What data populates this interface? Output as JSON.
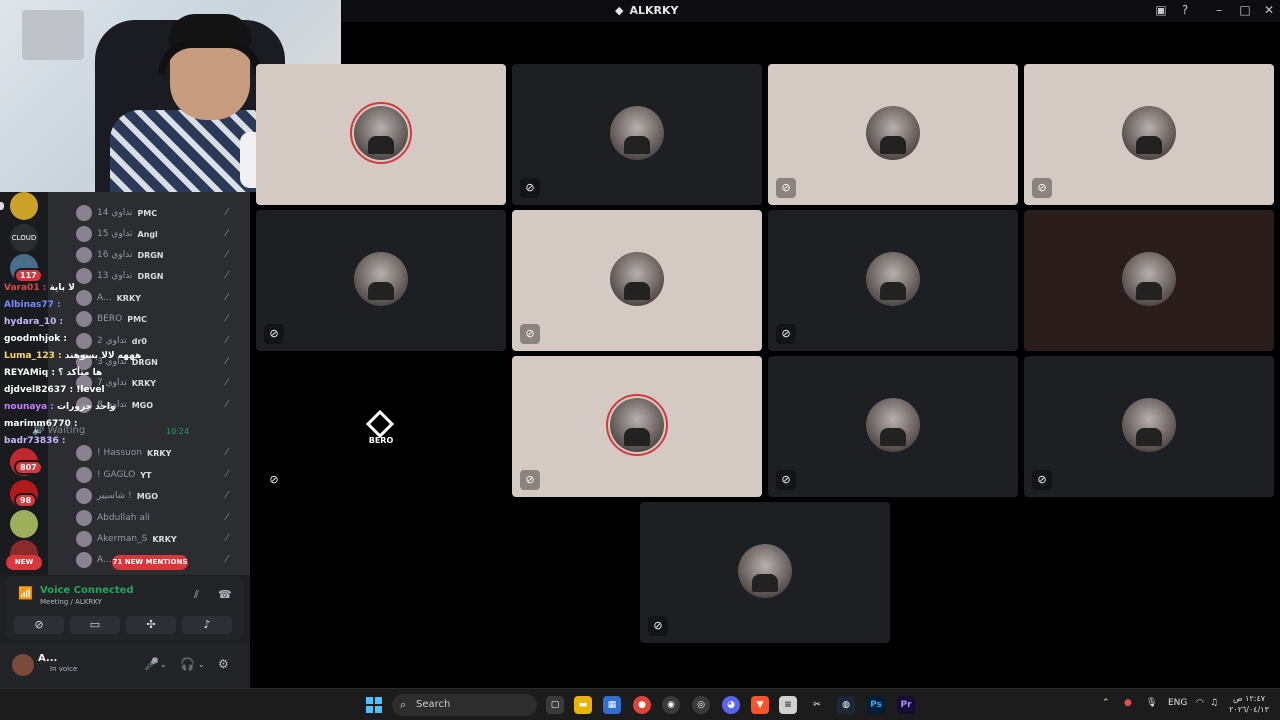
{
  "window": {
    "title": "ALKRKY"
  },
  "members": [
    {
      "name": "تداوي 14",
      "tag": "PMC"
    },
    {
      "name": "تداوي 15",
      "tag": "Angl"
    },
    {
      "name": "تداوي 16",
      "tag": "DRGN"
    },
    {
      "name": "تداوي 13",
      "tag": "DRGN"
    },
    {
      "name": "A...",
      "tag": "KRKY"
    },
    {
      "name": "BERO",
      "tag": "PMC"
    },
    {
      "name": "تداوي 2",
      "tag": "dr0"
    },
    {
      "name": "تداوي 3",
      "tag": "DRGN"
    },
    {
      "name": "تداوي 7",
      "tag": "KRKY"
    },
    {
      "name": "تداوي 8",
      "tag": "MGO"
    },
    {
      "name": "! Hassuon",
      "tag": "KRKY"
    },
    {
      "name": "! GAGLO",
      "tag": "YT"
    },
    {
      "name": "شاسيير !",
      "tag": "MGO"
    },
    {
      "name": "Abdullah ali",
      "tag": ""
    },
    {
      "name": "Akerman_S",
      "tag": "KRKY"
    },
    {
      "name": "A...",
      "tag": ""
    }
  ],
  "waiting": {
    "label": "Waiting",
    "time": "10:24"
  },
  "mentions": {
    "label": "71 NEW MENTIONS"
  },
  "new_pill": "NEW",
  "guild_badges": [
    "117",
    "807",
    "98"
  ],
  "chat": [
    {
      "user": "Vara01 :",
      "text": "لا باية",
      "color": "#d84a4a"
    },
    {
      "user": "Albinas77 :",
      "text": "",
      "color": "#7a8cff"
    },
    {
      "user": "hydara_10 :",
      "text": "",
      "color": "#c9b5ff"
    },
    {
      "user": "goodmhjok :",
      "text": "",
      "color": "#ffffff"
    },
    {
      "user": "Luma_123 :",
      "text": "هههه لالا بسوهند",
      "color": "#ffd966"
    },
    {
      "user": "REYAMiq :",
      "text": "ها متأكد ؟",
      "color": "#ffffff"
    },
    {
      "user": "djdvel82637 :",
      "text": "!level",
      "color": "#ffffff"
    },
    {
      "user": "nounaya :",
      "text": "واحد حزورات",
      "color": "#c77dff"
    },
    {
      "user": "marimm6770 :",
      "text": "",
      "color": "#ffffff"
    },
    {
      "user": "badr73836 :",
      "text": "",
      "color": "#c9b5ff"
    }
  ],
  "voice": {
    "status": "Voice Connected",
    "channel": "Meeting / ALKRKY"
  },
  "user": {
    "name": "A...",
    "status": "In voice"
  },
  "tiles": [
    {
      "style": "light"
    },
    {
      "style": "dark"
    },
    {
      "style": "light"
    },
    {
      "style": "light"
    },
    {
      "style": "dark"
    },
    {
      "style": "light"
    },
    {
      "style": "dark"
    },
    {
      "style": "brown"
    },
    {
      "style": "black",
      "name": "BERO"
    },
    {
      "style": "light"
    },
    {
      "style": "dark"
    },
    {
      "style": "dark"
    },
    {
      "style": "dark"
    }
  ],
  "taskbar": {
    "search_placeholder": "Search",
    "lang": "ENG",
    "clock_time": "١٢:٤٧ ص",
    "clock_date": "٢٠٢٦/٠٤/١٣"
  }
}
